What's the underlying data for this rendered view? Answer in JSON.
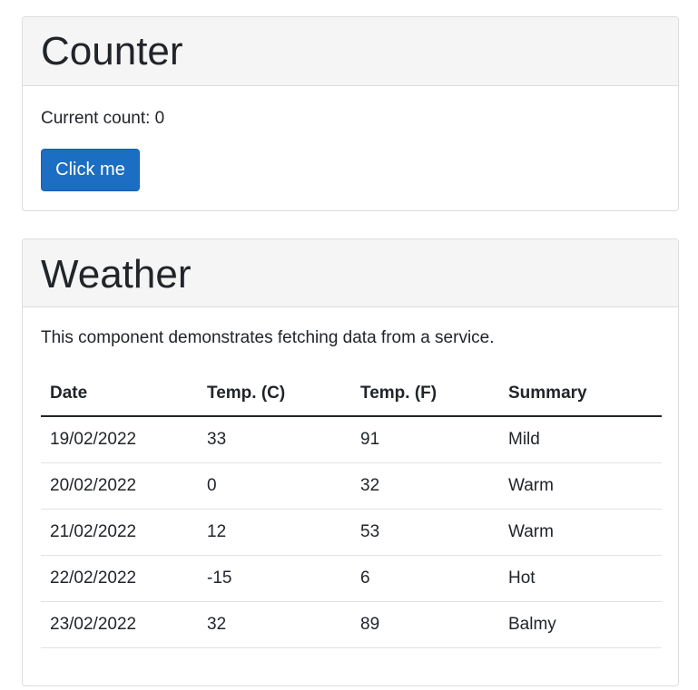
{
  "counter": {
    "title": "Counter",
    "count_text": "Current count: 0",
    "button_label": "Click me"
  },
  "weather": {
    "title": "Weather",
    "description": "This component demonstrates fetching data from a service.",
    "columns": [
      "Date",
      "Temp. (C)",
      "Temp. (F)",
      "Summary"
    ],
    "rows": [
      [
        "19/02/2022",
        "33",
        "91",
        "Mild"
      ],
      [
        "20/02/2022",
        "0",
        "32",
        "Warm"
      ],
      [
        "21/02/2022",
        "12",
        "53",
        "Warm"
      ],
      [
        "22/02/2022",
        "-15",
        "6",
        "Hot"
      ],
      [
        "23/02/2022",
        "32",
        "89",
        "Balmy"
      ]
    ]
  },
  "colors": {
    "primary_button": "#1b6ec2",
    "header_bg": "#f5f5f5"
  }
}
